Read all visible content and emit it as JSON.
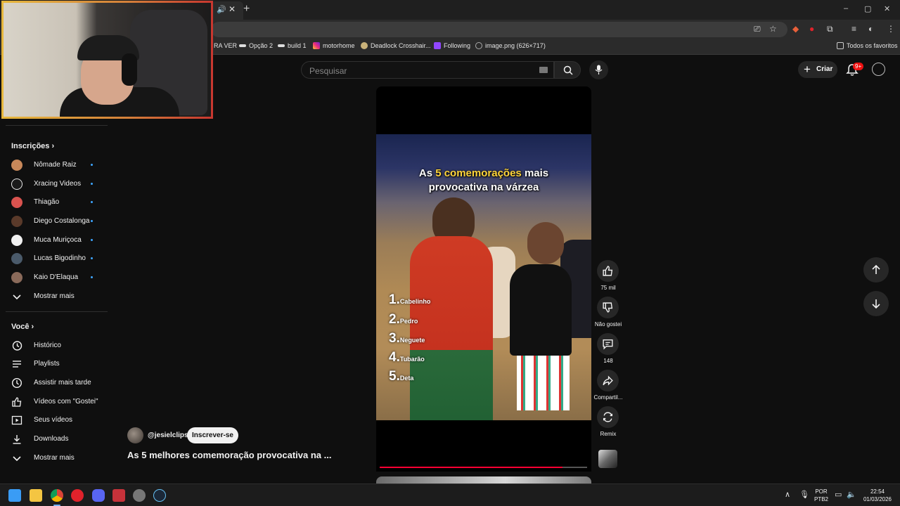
{
  "browser": {
    "tab_audio_icon": "speaker-icon",
    "tab_close": "✕",
    "new_tab": "+",
    "window_controls": [
      "–",
      "▢",
      "✕"
    ]
  },
  "bookmarks": {
    "items": [
      {
        "label": "RA VER",
        "icon": "none",
        "color": "#2b2b2b"
      },
      {
        "label": "Opção 2",
        "icon": "generic-favicon-icon",
        "color": "#dddddd"
      },
      {
        "label": "build 1",
        "icon": "generic-favicon-icon",
        "color": "#dddddd"
      },
      {
        "label": "motorhome",
        "icon": "instagram-icon",
        "color": "#e1306c"
      },
      {
        "label": "Deadlock Crosshair...",
        "icon": "crosshair-icon",
        "color": "#c9b27a"
      },
      {
        "label": "Following",
        "icon": "twitch-icon",
        "color": "#9146ff"
      },
      {
        "label": "image.png (626×717)",
        "icon": "globe-icon",
        "color": "#aaaaaa"
      }
    ],
    "all_bookmarks": "Todos os favoritos"
  },
  "header": {
    "search_placeholder": "Pesquisar",
    "create_label": "Criar",
    "notifications_badge": "9+"
  },
  "sidebar": {
    "subscriptions_title": "Inscrições",
    "subscriptions": [
      {
        "name": "Nômade Raiz",
        "color": "#c8885a"
      },
      {
        "name": "Xracing Videos",
        "color": "#e8e8e8"
      },
      {
        "name": "Thiagão",
        "color": "#d9534f"
      },
      {
        "name": "Diego Costalonga",
        "color": "#5a3a2a"
      },
      {
        "name": "Muca Muriçoca",
        "color": "#f0f0f0"
      },
      {
        "name": "Lucas Bigodinho",
        "color": "#4a5a6a"
      },
      {
        "name": "Kaio D'Elaqua",
        "color": "#8a6a5a"
      }
    ],
    "show_more": "Mostrar mais",
    "you_title": "Você",
    "you_items": [
      {
        "label": "Histórico",
        "icon": "history-icon"
      },
      {
        "label": "Playlists",
        "icon": "playlists-icon"
      },
      {
        "label": "Assistir mais tarde",
        "icon": "watch-later-icon"
      },
      {
        "label": "Vídeos com \"Gostei\"",
        "icon": "like-icon"
      },
      {
        "label": "Seus vídeos",
        "icon": "your-videos-icon"
      },
      {
        "label": "Downloads",
        "icon": "download-icon"
      }
    ],
    "you_show_more": "Mostrar mais"
  },
  "short": {
    "caption_pre": "As ",
    "caption_highlight": "5 comemorações",
    "caption_post": " mais",
    "caption_line2": "provocativa na várzea",
    "list": [
      {
        "num": "1.",
        "text": "Cabelinho"
      },
      {
        "num": "2.",
        "text": "Pedro"
      },
      {
        "num": "3.",
        "text": "Neguete"
      },
      {
        "num": "4.",
        "text": "Tubarão"
      },
      {
        "num": "5.",
        "text": "Deta"
      }
    ],
    "channel": "@jesielclips",
    "subscribe": "Inscrever-se",
    "title": "As 5 melhores comemoração provocativa na ...",
    "progress": 0.88
  },
  "actions": {
    "likes": "75 mil",
    "dislike": "Não gostei",
    "comments": "148",
    "share": "Compartil...",
    "remix": "Remix"
  },
  "taskbar": {
    "language": "POR",
    "layout": "PTB2",
    "time": "22:54",
    "date": "01/03/2026",
    "apps": [
      {
        "name": "windows-start-icon",
        "color": "#3a9cf5"
      },
      {
        "name": "file-explorer-icon",
        "color": "#f4c542"
      },
      {
        "name": "chrome-icon",
        "color": "#4a8df0"
      },
      {
        "name": "opera-icon",
        "color": "#e0222b"
      },
      {
        "name": "discord-icon",
        "color": "#5865f2"
      },
      {
        "name": "streamdeck-icon",
        "color": "#c7323a"
      },
      {
        "name": "app-icon",
        "color": "#777777"
      },
      {
        "name": "steam-icon",
        "color": "#1b2838"
      }
    ]
  }
}
